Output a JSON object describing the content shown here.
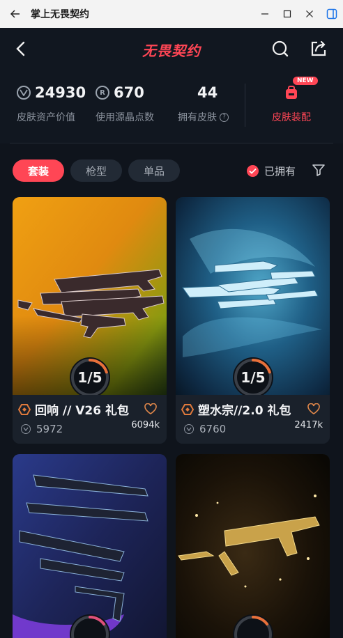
{
  "window": {
    "title": "掌上无畏契约"
  },
  "header": {
    "logo": "无畏契约"
  },
  "stats": {
    "asset_value": "24930",
    "asset_label": "皮肤资产价值",
    "points_used": "670",
    "points_label": "使用源晶点数",
    "skins_owned": "44",
    "skins_label": "拥有皮肤",
    "equip_badge": "NEW",
    "equip_label": "皮肤装配"
  },
  "filters": {
    "tabs": [
      "套装",
      "枪型",
      "单品"
    ],
    "owned_label": "已拥有"
  },
  "cards": [
    {
      "name": "回响 // V26 礼包",
      "progress": "1/5",
      "progress_fraction": 0.2,
      "price": "5972",
      "likes": "6094k"
    },
    {
      "name": "塑水宗//2.0 礼包",
      "progress": "1/5",
      "progress_fraction": 0.2,
      "price": "6760",
      "likes": "2417k"
    },
    {
      "name": "",
      "progress": "",
      "price": "",
      "likes": ""
    },
    {
      "name": "",
      "progress": "",
      "price": "",
      "likes": ""
    }
  ],
  "colors": {
    "accent": "#ff4655",
    "background": "#0f141c",
    "card": "#1a212b"
  }
}
